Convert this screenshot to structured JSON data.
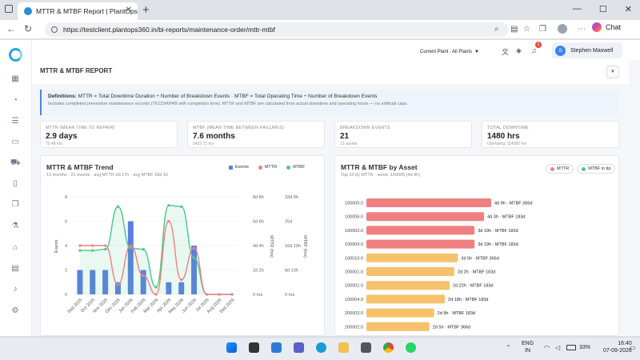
{
  "browser": {
    "tab_title": "MTTR & MTBF Report | PlantOps",
    "url": "https://testclient.plantops360.in/bi-reports/maintenance-order/mttr-mtbf",
    "chat_label": "Chat"
  },
  "topbar": {
    "plant_label": "Current Plant : All Plants",
    "notif_count": "1",
    "user_name": "Stephen Maxwell",
    "user_initial": "S"
  },
  "page": {
    "title": "MTTR & MTBF REPORT"
  },
  "definitions": {
    "label": "Definitions:",
    "line1": "MTTR = Total Downtime Duration ÷ Number of Breakdown Events · MTBF = Total Operating Time ÷ Number of Breakdown Events",
    "line2": "Includes completed preventive maintenance records (TECO/KPAB with completion time). MTTR and MTBF are calculated from actual downtime and operating hours — no artificial caps."
  },
  "kpis": [
    {
      "label": "MTTR (MEAN TIME TO REPAIR)",
      "value": "2.9 days",
      "sub": "70.48 hrs"
    },
    {
      "label": "MTBF (MEAN TIME BETWEEN FAILURES)",
      "value": "7.6 months",
      "sub": "5432.71 hrs"
    },
    {
      "label": "BREAKDOWN EVENTS",
      "value": "21",
      "sub": "13 assets"
    },
    {
      "label": "TOTAL DOWNTIME",
      "value": "1480 hrs",
      "sub": "Operating: 114082 hrs"
    }
  ],
  "colors": {
    "events": "#5b7fe0",
    "mttr": "#f08080",
    "mtbf": "#48c78e",
    "mtbf_bar": "#f5c26b"
  },
  "chart_data": [
    {
      "type": "bar",
      "title": "MTTR & MTBF Trend",
      "subtitle": "13 months · 21 events · avg MTTR 2d 17h · avg MTBF 18d 1h",
      "legend": [
        "Events",
        "MTTR",
        "MTBF"
      ],
      "categories": [
        "Sep 2025",
        "Oct 2025",
        "Nov 2025",
        "Dec 2025",
        "Jan 2026",
        "Feb 2026",
        "Mar 2026",
        "Apr 2026",
        "May 2026",
        "Jun 2026",
        "Jul 2026",
        "Aug 2026",
        "Sep 2026"
      ],
      "y_left": {
        "label": "Events",
        "ticks": [
          "0",
          "2",
          "4",
          "6",
          "8"
        ],
        "range": [
          0,
          8
        ]
      },
      "y_mttr": {
        "label": "MTTR (hrs)",
        "ticks": [
          "0 hrs",
          "2d 2h",
          "4d 4h",
          "6d 6h",
          "8d 8h"
        ],
        "range": [
          0,
          200
        ]
      },
      "y_mtbf": {
        "label": "MTBF (hrs)",
        "ticks": [
          "0 hrs",
          "8d 10h",
          "16d 19h",
          "25d",
          "33d 8h"
        ],
        "range": [
          0,
          800
        ]
      },
      "series": [
        {
          "name": "Events",
          "type": "bar",
          "values": [
            2,
            2,
            2,
            1,
            6,
            2,
            0,
            1,
            1,
            4,
            0,
            0,
            0
          ]
        },
        {
          "name": "MTTR",
          "type": "line",
          "values": [
            100,
            100,
            100,
            20,
            100,
            38,
            0,
            150,
            30,
            95,
            0,
            0,
            0
          ]
        },
        {
          "name": "MTBF",
          "type": "area",
          "values": [
            360,
            360,
            370,
            720,
            380,
            370,
            60,
            730,
            720,
            300,
            0,
            0,
            0
          ]
        }
      ]
    },
    {
      "type": "bar",
      "orientation": "horizontal",
      "title": "MTTR & MTBF by Asset",
      "subtitle": "Top 10 by MTTR · worst: 100005 (4d 9h)",
      "legend": [
        "MTTR",
        "MTBF in tip"
      ],
      "categories": [
        "100005.0",
        "100006.0",
        "100002.0",
        "100009.0",
        "100010.0",
        "200001.0",
        "100001.0",
        "100004.0",
        "200003.0",
        "200002.0"
      ],
      "labels": [
        "4d 9h · MTBF 366d",
        "4d 3h · MTBF 183d",
        "3d 19h · MTBF 183d",
        "3d 19h · MTBF 183d",
        "3d 5h · MTBF 366d",
        "2d 2h · MTBF 183d",
        "2d 22h · MTBF 183d",
        "2d 18h · MTBF 183d",
        "2d 9h · MTBF 183d",
        "2d 5h · MTBF 366d"
      ],
      "series": [
        {
          "name": "MTTR",
          "values": [
            105,
            99,
            91,
            91,
            77,
            74,
            70,
            66,
            57,
            53
          ],
          "unit": "hrs"
        }
      ],
      "bar_colors": [
        "mttr",
        "mttr",
        "mttr",
        "mttr",
        "mtbf_bar",
        "mtbf_bar",
        "mtbf_bar",
        "mtbf_bar",
        "mtbf_bar",
        "mtbf_bar"
      ]
    }
  ],
  "taskbar": {
    "lang1": "ENG",
    "lang2": "IN",
    "battery": "33%",
    "time": "16:40",
    "date": "07-09-2026"
  }
}
